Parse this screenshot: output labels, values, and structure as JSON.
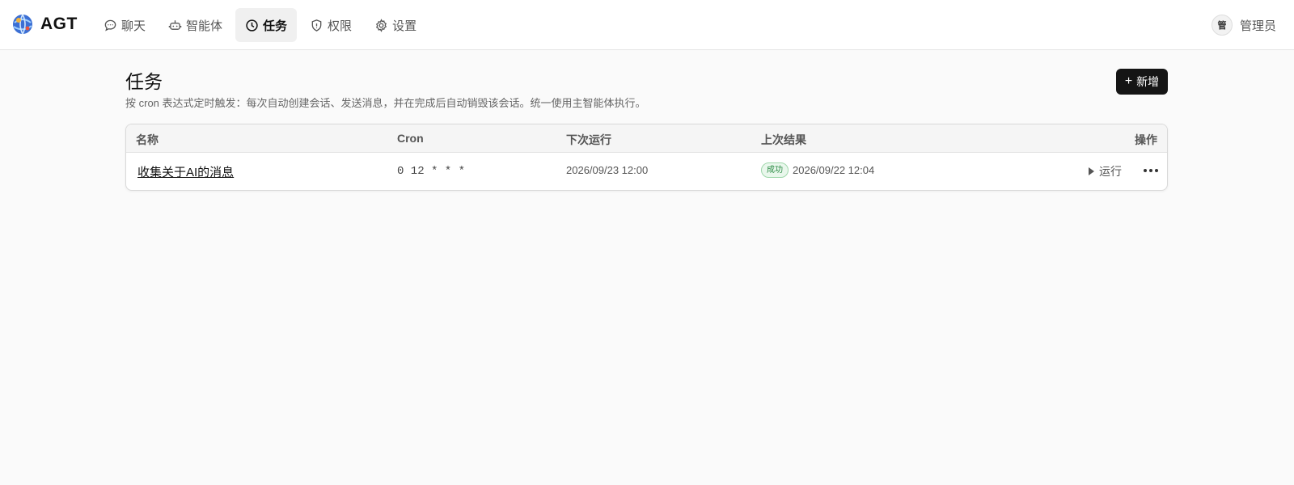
{
  "app": {
    "logo_text": "AGT",
    "logo_icon": "globe-logo-icon"
  },
  "nav": {
    "items": [
      {
        "label": "聊天",
        "icon": "chat-bubble-icon",
        "active": false
      },
      {
        "label": "智能体",
        "icon": "robot-icon",
        "active": false
      },
      {
        "label": "任务",
        "icon": "clock-icon",
        "active": true
      },
      {
        "label": "权限",
        "icon": "shield-icon",
        "active": false
      },
      {
        "label": "设置",
        "icon": "gear-icon",
        "active": false
      }
    ]
  },
  "user": {
    "avatar_text": "管",
    "name": "管理员"
  },
  "page": {
    "title": "任务",
    "description": "按 cron 表达式定时触发：每次自动创建会话、发送消息，并在完成后自动销毁该会话。统一使用主智能体执行。",
    "add_button": "新增"
  },
  "table": {
    "columns": [
      "名称",
      "Cron",
      "下次运行",
      "上次结果",
      "操作"
    ],
    "rows": [
      {
        "name": "收集关于AI的消息",
        "cron": "0 12 * * *",
        "next_run": "2026/09/23 12:00",
        "last_status": "成功",
        "last_time": "2026/09/22 12:04",
        "run_label": "运行"
      }
    ]
  },
  "colors": {
    "primary_button": "#151515",
    "success_badge_bg": "#e9f7ec",
    "success_badge_text": "#2a8a43",
    "active_nav_bg": "#f0f0f0"
  }
}
